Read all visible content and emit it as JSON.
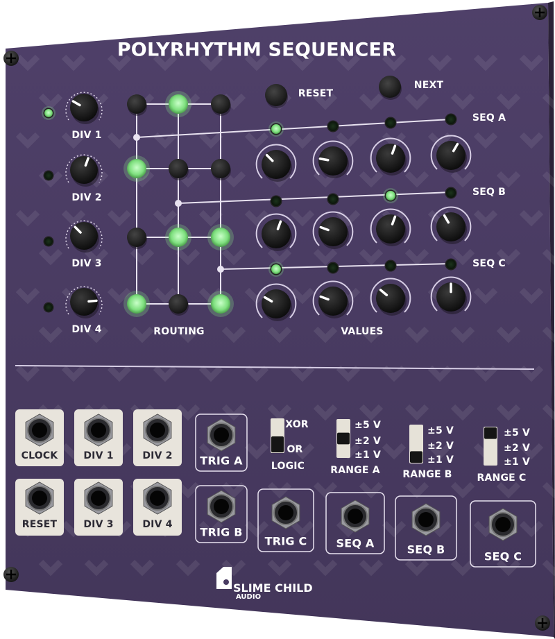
{
  "module": {
    "title": "POLYRHYTHM SEQUENCER",
    "brand_line1": "SLIME CHILD",
    "brand_line2": "AUDIO",
    "colors": {
      "panel": "#4a3c63",
      "led_on": "#8ff08f",
      "led_off": "#1a2a1a",
      "accent_line": "#e6e0f0"
    }
  },
  "dividers": [
    {
      "label": "DIV 1",
      "led": "on"
    },
    {
      "label": "DIV 2",
      "led": "off"
    },
    {
      "label": "DIV 3",
      "led": "off"
    },
    {
      "label": "DIV 4",
      "led": "off"
    }
  ],
  "sections": {
    "routing": "ROUTING",
    "values": "VALUES"
  },
  "buttons": {
    "reset": "RESET",
    "next": "NEXT"
  },
  "routing_grid": [
    [
      "off",
      "on",
      "off"
    ],
    [
      "on",
      "off",
      "off"
    ],
    [
      "off",
      "on",
      "on"
    ],
    [
      "on",
      "off",
      "on"
    ]
  ],
  "sequences": [
    {
      "label": "SEQ A",
      "steps": [
        "on",
        "off",
        "off",
        "off"
      ]
    },
    {
      "label": "SEQ B",
      "steps": [
        "off",
        "off",
        "on",
        "off"
      ]
    },
    {
      "label": "SEQ C",
      "steps": [
        "on",
        "off",
        "off",
        "off"
      ]
    }
  ],
  "logic_switch": {
    "label": "LOGIC",
    "options": [
      "XOR",
      "OR"
    ],
    "selected": "OR"
  },
  "range_switches": [
    {
      "label": "RANGE A",
      "options": [
        "±5 V",
        "±2 V",
        "±1 V"
      ],
      "selected": "±2 V"
    },
    {
      "label": "RANGE B",
      "options": [
        "±5 V",
        "±2 V",
        "±1 V"
      ],
      "selected": "±1 V"
    },
    {
      "label": "RANGE C",
      "options": [
        "±5 V",
        "±2 V",
        "±1 V"
      ],
      "selected": "±5 V"
    }
  ],
  "jacks": {
    "inputs_top": [
      "CLOCK",
      "DIV 1",
      "DIV 2"
    ],
    "inputs_bottom": [
      "RESET",
      "DIV 3",
      "DIV 4"
    ],
    "outputs": [
      "TRIG A",
      "TRIG B",
      "TRIG C",
      "SEQ A",
      "SEQ B",
      "SEQ C"
    ]
  }
}
